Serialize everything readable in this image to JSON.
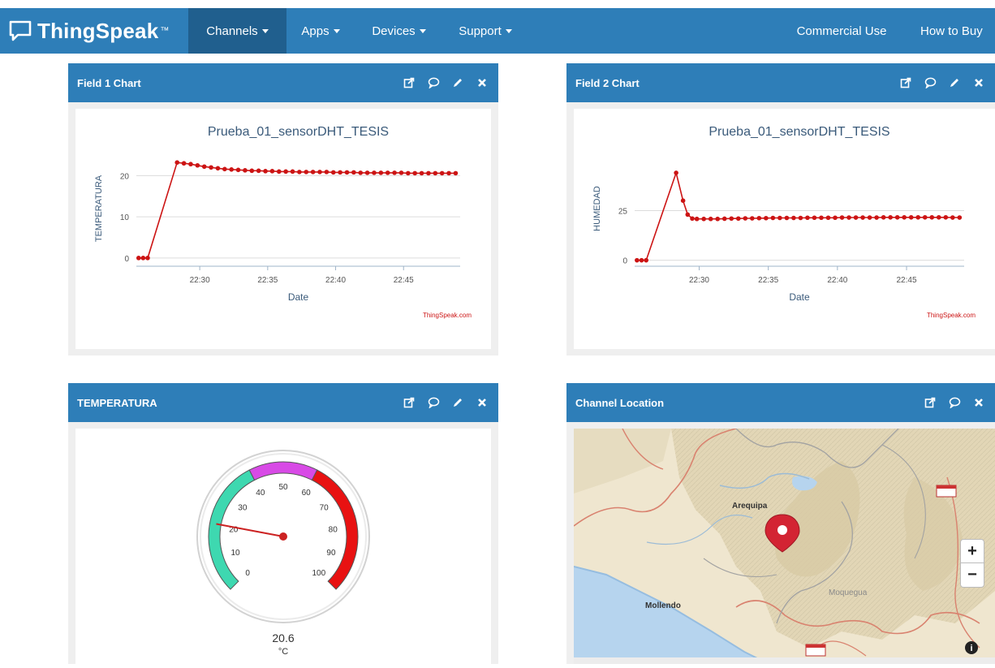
{
  "navbar": {
    "brand": "ThingSpeak",
    "brand_tm": "™",
    "items": [
      {
        "label": "Channels",
        "caret": true
      },
      {
        "label": "Apps",
        "caret": true
      },
      {
        "label": "Devices",
        "caret": true
      },
      {
        "label": "Support",
        "caret": true
      }
    ],
    "right_items": [
      {
        "label": "Commercial Use"
      },
      {
        "label": "How to Buy"
      }
    ]
  },
  "panels": {
    "field1": {
      "title": "Field 1 Chart",
      "tools": [
        "external-link-icon",
        "comment-icon",
        "pencil-icon",
        "close-icon"
      ]
    },
    "field2": {
      "title": "Field 2 Chart",
      "tools": [
        "external-link-icon",
        "comment-icon",
        "pencil-icon",
        "close-icon"
      ]
    },
    "gauge": {
      "title": "TEMPERATURA",
      "tools": [
        "external-link-icon",
        "comment-icon",
        "pencil-icon",
        "close-icon"
      ]
    },
    "location": {
      "title": "Channel Location",
      "tools": [
        "external-link-icon",
        "comment-icon",
        "close-icon"
      ]
    }
  },
  "chart_data": [
    {
      "type": "line",
      "title": "Prueba_01_sensorDHT_TESIS",
      "xlabel": "Date",
      "ylabel": "TEMPERATURA",
      "credit": "ThingSpeak.com",
      "x_ticks": [
        "22:30",
        "22:35",
        "22:40",
        "22:45"
      ],
      "y_ticks": [
        0,
        10,
        20
      ],
      "ylim": [
        -2,
        26
      ],
      "xlim": [
        "22:25:20",
        "22:49:10"
      ],
      "series": [
        {
          "color": "#cc1414",
          "x": [
            "22:25:30",
            "22:25:50",
            "22:26:10",
            "22:28:20",
            "22:28:50",
            "22:29:20",
            "22:29:50",
            "22:30:20",
            "22:30:50",
            "22:31:20",
            "22:31:50",
            "22:32:20",
            "22:32:50",
            "22:33:20",
            "22:33:50",
            "22:34:20",
            "22:34:50",
            "22:35:20",
            "22:35:50",
            "22:36:20",
            "22:36:50",
            "22:37:20",
            "22:37:50",
            "22:38:20",
            "22:38:50",
            "22:39:20",
            "22:39:50",
            "22:40:20",
            "22:40:50",
            "22:41:20",
            "22:41:50",
            "22:42:20",
            "22:42:50",
            "22:43:20",
            "22:43:50",
            "22:44:20",
            "22:44:50",
            "22:45:20",
            "22:45:50",
            "22:46:20",
            "22:46:50",
            "22:47:20",
            "22:47:50",
            "22:48:20",
            "22:48:50"
          ],
          "y": [
            0,
            0,
            0,
            23.2,
            23.0,
            22.8,
            22.5,
            22.2,
            22.0,
            21.8,
            21.6,
            21.5,
            21.4,
            21.3,
            21.2,
            21.2,
            21.1,
            21.1,
            21.0,
            21.0,
            21.0,
            20.9,
            20.9,
            20.9,
            20.9,
            20.9,
            20.8,
            20.8,
            20.8,
            20.8,
            20.7,
            20.7,
            20.7,
            20.7,
            20.7,
            20.7,
            20.7,
            20.6,
            20.6,
            20.6,
            20.6,
            20.6,
            20.6,
            20.6,
            20.6
          ]
        }
      ]
    },
    {
      "type": "line",
      "title": "Prueba_01_sensorDHT_TESIS",
      "xlabel": "Date",
      "ylabel": "HUMEDAD",
      "credit": "ThingSpeak.com",
      "x_ticks": [
        "22:30",
        "22:35",
        "22:40",
        "22:45"
      ],
      "y_ticks": [
        0,
        25
      ],
      "ylim": [
        -3,
        55
      ],
      "xlim": [
        "22:25:20",
        "22:49:10"
      ],
      "series": [
        {
          "color": "#cc1414",
          "x": [
            "22:25:30",
            "22:25:50",
            "22:26:10",
            "22:28:20",
            "22:28:50",
            "22:29:10",
            "22:29:30",
            "22:29:50",
            "22:30:20",
            "22:30:50",
            "22:31:20",
            "22:31:50",
            "22:32:20",
            "22:32:50",
            "22:33:20",
            "22:33:50",
            "22:34:20",
            "22:34:50",
            "22:35:20",
            "22:35:50",
            "22:36:20",
            "22:36:50",
            "22:37:20",
            "22:37:50",
            "22:38:20",
            "22:38:50",
            "22:39:20",
            "22:39:50",
            "22:40:20",
            "22:40:50",
            "22:41:20",
            "22:41:50",
            "22:42:20",
            "22:42:50",
            "22:43:20",
            "22:43:50",
            "22:44:20",
            "22:44:50",
            "22:45:20",
            "22:45:50",
            "22:46:20",
            "22:46:50",
            "22:47:20",
            "22:47:50",
            "22:48:20",
            "22:48:50"
          ],
          "y": [
            0,
            0,
            0,
            44,
            30,
            23,
            21,
            20.8,
            20.8,
            20.8,
            20.8,
            20.9,
            21.0,
            21.0,
            21.1,
            21.1,
            21.2,
            21.2,
            21.3,
            21.3,
            21.3,
            21.3,
            21.3,
            21.4,
            21.4,
            21.4,
            21.4,
            21.4,
            21.5,
            21.5,
            21.5,
            21.5,
            21.5,
            21.5,
            21.6,
            21.6,
            21.6,
            21.6,
            21.6,
            21.6,
            21.6,
            21.6,
            21.6,
            21.6,
            21.5,
            21.5
          ]
        }
      ]
    }
  ],
  "gauge": {
    "value": "20.6",
    "value_num": 20.6,
    "unit": "°C",
    "min": 0,
    "max": 100,
    "tick_labels": [
      "0",
      "10",
      "20",
      "30",
      "40",
      "50",
      "60",
      "70",
      "80",
      "90",
      "100"
    ],
    "bands": [
      {
        "from": 0,
        "to": 40,
        "color": "#3ed8b0"
      },
      {
        "from": 40,
        "to": 60,
        "color": "#d84ae6"
      },
      {
        "from": 60,
        "to": 100,
        "color": "#e81212"
      }
    ]
  },
  "map": {
    "labels": [
      "Arequipa",
      "Mollendo",
      "Moquegua"
    ],
    "zoom_in": "+",
    "zoom_out": "−",
    "info": "i",
    "marker_color": "#d32433"
  }
}
